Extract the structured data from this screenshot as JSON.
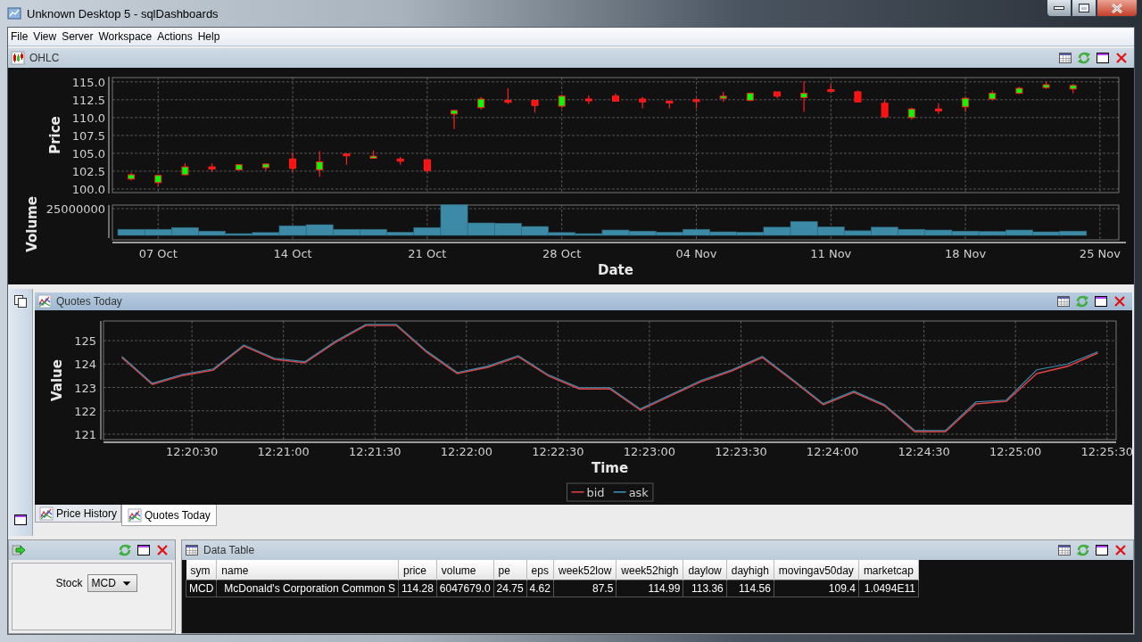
{
  "window": {
    "title": "Unknown Desktop 5 - sqlDashboards"
  },
  "menu": [
    "File",
    "View",
    "Server",
    "Workspace",
    "Actions",
    "Help"
  ],
  "ohlc_panel": {
    "title": "OHLC",
    "chart_data": {
      "type": "candlestick",
      "xlabel": "Date",
      "ylabel": "Price",
      "grid": true,
      "categories": [
        null,
        "07 Oct",
        null,
        null,
        null,
        null,
        "14 Oct",
        null,
        null,
        null,
        null,
        "21 Oct",
        null,
        null,
        null,
        null,
        "28 Oct",
        null,
        null,
        null,
        null,
        "04 Nov",
        null,
        null,
        null,
        null,
        "11 Nov",
        null,
        null,
        null,
        null,
        "18 Nov",
        null,
        null,
        null,
        null,
        "25 Nov"
      ],
      "ylim": [
        99.5,
        115.6
      ],
      "yticks": [
        {
          "value": 100,
          "label": "100.0"
        },
        {
          "value": 102.5,
          "label": "102.5"
        },
        {
          "value": 105,
          "label": "105.0"
        },
        {
          "value": 107.5,
          "label": "107.5"
        },
        {
          "value": 110,
          "label": "110.0"
        },
        {
          "value": 112.5,
          "label": "112.5"
        },
        {
          "value": 115,
          "label": "115.0"
        }
      ],
      "ohlc": [
        [
          101.4,
          102.3,
          101.2,
          102.0
        ],
        [
          100.9,
          102.0,
          100.4,
          101.9
        ],
        [
          102.0,
          103.6,
          101.9,
          103.1
        ],
        [
          103.1,
          103.6,
          102.4,
          102.8
        ],
        [
          102.7,
          103.5,
          102.6,
          103.4
        ],
        [
          103.0,
          103.6,
          102.6,
          103.5
        ],
        [
          104.2,
          105.1,
          102.4,
          102.9
        ],
        [
          102.7,
          105.3,
          101.7,
          103.8
        ],
        [
          104.9,
          105.0,
          103.4,
          104.8
        ],
        [
          104.3,
          105.4,
          104.3,
          104.6
        ],
        [
          104.2,
          104.5,
          103.4,
          103.9
        ],
        [
          104.1,
          104.1,
          102.3,
          102.6
        ],
        [
          110.5,
          111.1,
          108.4,
          111.0
        ],
        [
          111.4,
          112.9,
          111.1,
          112.6
        ],
        [
          112.4,
          114.1,
          111.9,
          112.3
        ],
        [
          112.4,
          112.4,
          110.7,
          111.7
        ],
        [
          111.6,
          113.2,
          111.3,
          113.0
        ],
        [
          112.6,
          113.1,
          111.9,
          112.4
        ],
        [
          113.0,
          113.4,
          112.3,
          112.3
        ],
        [
          112.6,
          112.9,
          111.3,
          112.2
        ],
        [
          112.3,
          112.4,
          111.3,
          112.1
        ],
        [
          112.5,
          112.7,
          111.3,
          112.3
        ],
        [
          112.7,
          113.6,
          112.2,
          113.0
        ],
        [
          112.4,
          113.5,
          112.3,
          113.4
        ],
        [
          113.6,
          113.6,
          112.7,
          113.0
        ],
        [
          112.8,
          115.1,
          110.8,
          113.4
        ],
        [
          113.9,
          114.7,
          113.6,
          113.7
        ],
        [
          113.6,
          113.8,
          112.2,
          112.2
        ],
        [
          112.0,
          112.5,
          110.0,
          110.1
        ],
        [
          110.0,
          111.4,
          109.7,
          111.2
        ],
        [
          111.2,
          112.0,
          110.5,
          111.0
        ],
        [
          111.5,
          112.8,
          110.8,
          112.7
        ],
        [
          112.6,
          113.8,
          112.4,
          113.4
        ],
        [
          113.4,
          114.3,
          113.3,
          114.1
        ],
        [
          114.2,
          115.0,
          114.0,
          114.6
        ],
        [
          114.0,
          114.7,
          113.4,
          114.5
        ],
        null
      ]
    },
    "volume_plot": {
      "ylabel": "Volume",
      "tick": "25000000"
    }
  },
  "quotes_panel": {
    "title": "Quotes Today",
    "chart_data": {
      "type": "line",
      "xlabel": "Time",
      "ylabel": "Value",
      "grid": true,
      "legend": true,
      "x": [
        44407,
        44417,
        44427,
        44437,
        44447,
        44457,
        44467,
        44477,
        44487,
        44497,
        44507,
        44517,
        44527,
        44537,
        44547,
        44557,
        44567,
        44577,
        44587,
        44597,
        44607,
        44617,
        44627,
        44637,
        44647,
        44657,
        44667,
        44677,
        44687,
        44697,
        44707,
        44717,
        44727
      ],
      "xlim": [
        44401,
        44733
      ],
      "ylim": [
        120.77,
        125.84
      ],
      "xticks": [
        {
          "value": 44430,
          "label": "12:20:30"
        },
        {
          "value": 44460,
          "label": "12:21:00"
        },
        {
          "value": 44490,
          "label": "12:21:30"
        },
        {
          "value": 44520,
          "label": "12:22:00"
        },
        {
          "value": 44550,
          "label": "12:22:30"
        },
        {
          "value": 44580,
          "label": "12:23:00"
        },
        {
          "value": 44610,
          "label": "12:23:30"
        },
        {
          "value": 44640,
          "label": "12:24:00"
        },
        {
          "value": 44670,
          "label": "12:24:30"
        },
        {
          "value": 44700,
          "label": "12:25:00"
        },
        {
          "value": 44730,
          "label": "12:25:30"
        }
      ],
      "yticks": [
        121,
        122,
        123,
        124,
        125
      ],
      "series": [
        {
          "name": "bid",
          "color": "#d94040",
          "values": [
            124.28,
            123.13,
            123.51,
            123.74,
            124.77,
            124.2,
            124.05,
            124.92,
            125.65,
            125.65,
            124.5,
            123.59,
            123.86,
            124.31,
            123.48,
            122.94,
            122.94,
            122.03,
            122.64,
            123.25,
            123.7,
            124.28,
            123.29,
            122.26,
            122.79,
            122.22,
            121.11,
            121.11,
            122.3,
            122.41,
            123.59,
            123.9,
            124.47
          ]
        },
        {
          "name": "ask",
          "color": "#3a8fb7",
          "values": [
            124.33,
            123.18,
            123.56,
            123.79,
            124.82,
            124.25,
            124.1,
            124.97,
            125.7,
            125.7,
            124.55,
            123.64,
            123.91,
            124.36,
            123.53,
            122.99,
            122.99,
            122.08,
            122.69,
            123.3,
            123.75,
            124.33,
            123.34,
            122.31,
            122.84,
            122.27,
            121.16,
            121.16,
            122.38,
            122.46,
            123.75,
            124.0,
            124.52
          ]
        }
      ]
    },
    "tabs": [
      {
        "label": "Price History",
        "selected": false
      },
      {
        "label": "Quotes Today",
        "selected": true
      }
    ]
  },
  "stock_panel": {
    "label": "Stock",
    "value": "MCD"
  },
  "data_table": {
    "title": "Data Table",
    "columns": [
      "sym",
      "name",
      "price",
      "volume",
      "pe",
      "eps",
      "week52low",
      "week52high",
      "daylow",
      "dayhigh",
      "movingav50day",
      "marketcap"
    ],
    "rows": [
      [
        "MCD",
        "McDonald's Corporation Common S",
        "114.28",
        "6047679.0",
        "24.75",
        "4.62",
        "87.5",
        "114.99",
        "113.36",
        "114.56",
        "109.4",
        "1.0494E11"
      ]
    ]
  }
}
